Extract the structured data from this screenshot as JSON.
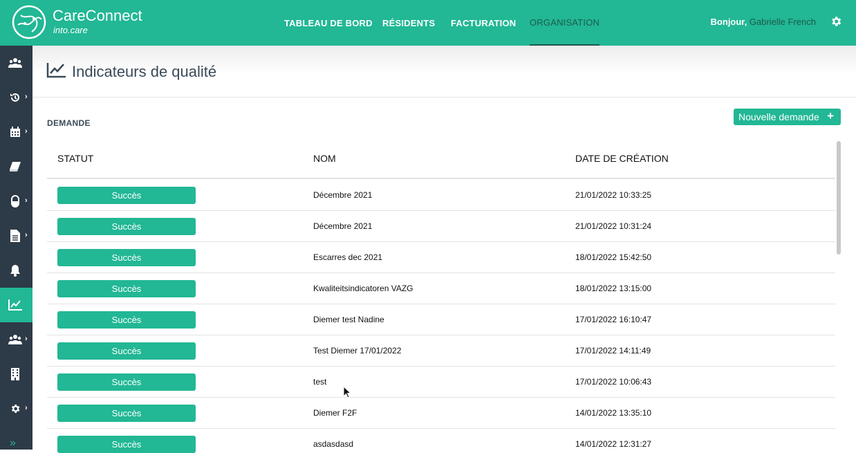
{
  "app": {
    "brand": "CareConnect",
    "subtitle": "into.care"
  },
  "nav": [
    {
      "label": "TABLEAU DE BORD",
      "active": false
    },
    {
      "label": "RÉSIDENTS",
      "active": false
    },
    {
      "label": "FACTURATION",
      "active": false
    },
    {
      "label": "ORGANISATION",
      "active": true
    }
  ],
  "user": {
    "greeting": "Bonjour,",
    "name": "Gabrielle French"
  },
  "sidebar": {
    "items": [
      {
        "icon": "users-icon",
        "chevron": false
      },
      {
        "icon": "history-icon",
        "chevron": true
      },
      {
        "icon": "calendar-icon",
        "chevron": true
      },
      {
        "icon": "book-icon",
        "chevron": false
      },
      {
        "icon": "pill-icon",
        "chevron": true
      },
      {
        "icon": "file-icon",
        "chevron": true
      },
      {
        "icon": "bell-icon",
        "chevron": false
      },
      {
        "icon": "line-chart-icon",
        "chevron": false,
        "active": true
      },
      {
        "icon": "group-icon",
        "chevron": true
      },
      {
        "icon": "building-icon",
        "chevron": false
      },
      {
        "icon": "gear-icon",
        "chevron": true
      }
    ],
    "expand_label": "»"
  },
  "page": {
    "title": "Indicateurs de qualité",
    "icon": "line-chart-icon"
  },
  "section": {
    "label": "DEMANDE",
    "new_button": "Nouvelle demande",
    "new_button_icon": "+"
  },
  "table": {
    "columns": [
      "STATUT",
      "NOM",
      "DATE DE CRÉATION"
    ],
    "rows": [
      {
        "status": "Succès",
        "name": "Décembre 2021",
        "date": "21/01/2022 10:33:25"
      },
      {
        "status": "Succès",
        "name": "Décembre 2021",
        "date": "21/01/2022 10:31:24"
      },
      {
        "status": "Succès",
        "name": "Escarres dec 2021",
        "date": "18/01/2022 15:42:50"
      },
      {
        "status": "Succès",
        "name": "Kwaliteitsindicatoren VAZG",
        "date": "18/01/2022 13:15:00"
      },
      {
        "status": "Succès",
        "name": "Diemer test Nadine",
        "date": "17/01/2022 16:10:47"
      },
      {
        "status": "Succès",
        "name": "Test Diemer 17/01/2022",
        "date": "17/01/2022 14:11:49"
      },
      {
        "status": "Succès",
        "name": "test",
        "date": "17/01/2022 10:06:43"
      },
      {
        "status": "Succès",
        "name": "Diemer F2F",
        "date": "14/01/2022 13:35:10"
      },
      {
        "status": "Succès",
        "name": "asdasdasd",
        "date": "14/01/2022 12:31:27"
      }
    ]
  },
  "colors": {
    "primary": "#22b795",
    "sidebar": "#2d3a48",
    "active_nav": "#1e5a4c",
    "title": "#3a4a58"
  }
}
